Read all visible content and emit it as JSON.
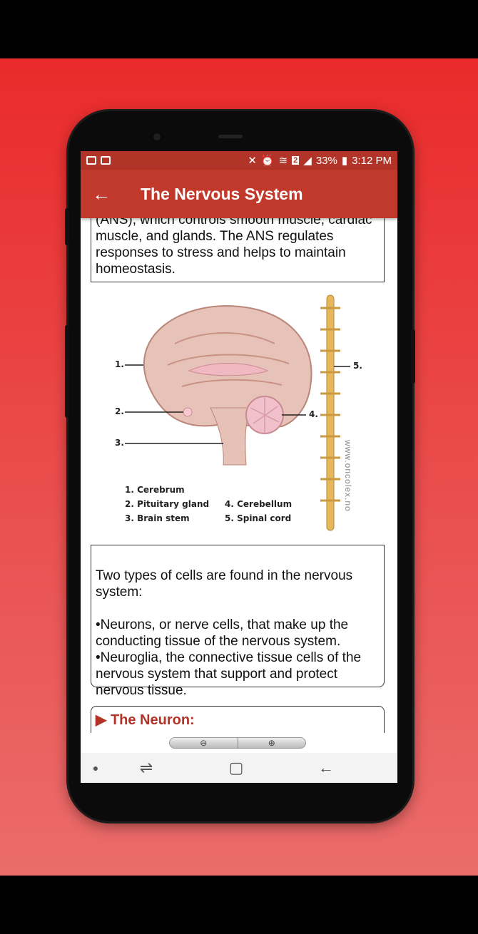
{
  "status_bar": {
    "battery": "33%",
    "time": "3:12 PM",
    "sim_badge": "2"
  },
  "app_bar": {
    "title": "The Nervous System",
    "back_icon": "arrow-left-icon"
  },
  "sections": {
    "ans_text": "(ANS), which controls smooth muscle, cardiac muscle, and glands. The ANS regulates responses to stress and helps to maintain homeostasis.",
    "cells_text": "Two types of cells are found in the nervous system:\n\n •Neurons, or nerve cells, that make up the conducting tissue of the nervous system.\n •Neuroglia, the connective tissue cells of the nervous system that support and protect nervous tissue.",
    "neuron_heading": "▶ The Neuron:"
  },
  "diagram": {
    "callouts": [
      "1.",
      "2.",
      "3.",
      "4.",
      "5."
    ],
    "legend": [
      "1. Cerebrum",
      "2. Pituitary gland",
      "3. Brain stem",
      "4. Cerebellum",
      "5. Spinal cord"
    ],
    "watermark": "www.oncolex.no"
  },
  "zoom_controls": {
    "zoom_out": "zoom-out-icon",
    "zoom_in": "zoom-in-icon"
  },
  "nav_bar": {
    "items": [
      "dot-icon",
      "recents-icon",
      "home-icon",
      "back-icon"
    ]
  }
}
